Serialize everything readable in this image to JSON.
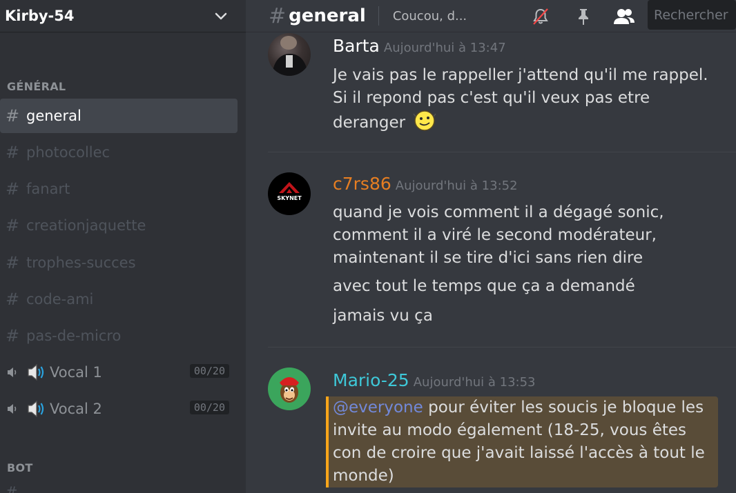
{
  "server": {
    "name": "Kirby-54"
  },
  "sidebar": {
    "categories": [
      {
        "label": "GÉNÉRAL"
      },
      {
        "label": "BOT"
      }
    ],
    "channels": [
      {
        "name": "general"
      },
      {
        "name": "photocollec"
      },
      {
        "name": "fanart"
      },
      {
        "name": "creationjaquette"
      },
      {
        "name": "trophes-succes"
      },
      {
        "name": "code-ami"
      },
      {
        "name": "pas-de-micro"
      }
    ],
    "voice_channels": [
      {
        "name": "Vocal 1",
        "count": "00/20"
      },
      {
        "name": "Vocal 2",
        "count": "00/20"
      }
    ]
  },
  "header": {
    "channel": "general",
    "topic": "Coucou, d...",
    "search_placeholder": "Rechercher"
  },
  "messages": [
    {
      "author": "Barta",
      "timestamp": "Aujourd'hui à 13:47",
      "lines": [
        "Je vais pas le rappeller j'attend qu'il me rappel. Si il repond pas c'est qu'il veux pas etre deranger"
      ],
      "avatar": "dark-photo"
    },
    {
      "author": "c7rs86",
      "author_color": "#e67e22",
      "timestamp": "Aujourd'hui à 13:52",
      "avatar_text": "SKYNET",
      "lines": [
        "quand je vois comment il a dégagé sonic, comment il a viré le second modérateur, maintenant il se tire d'ici sans rien dire",
        "avec tout le temps que ça a demandé",
        "jamais vu ça"
      ]
    },
    {
      "author": "Mario-25",
      "author_color": "#1abc9c",
      "timestamp": "Aujourd'hui à 13:53",
      "mention": "@everyone",
      "text": " pour éviter les soucis je bloque les invite au modo également (18-25, vous êtes con de croire que j'avait laissé l'accès à tout le monde)"
    }
  ],
  "colors": {
    "accent": "#7289da",
    "mention_bar": "#faa61a"
  }
}
